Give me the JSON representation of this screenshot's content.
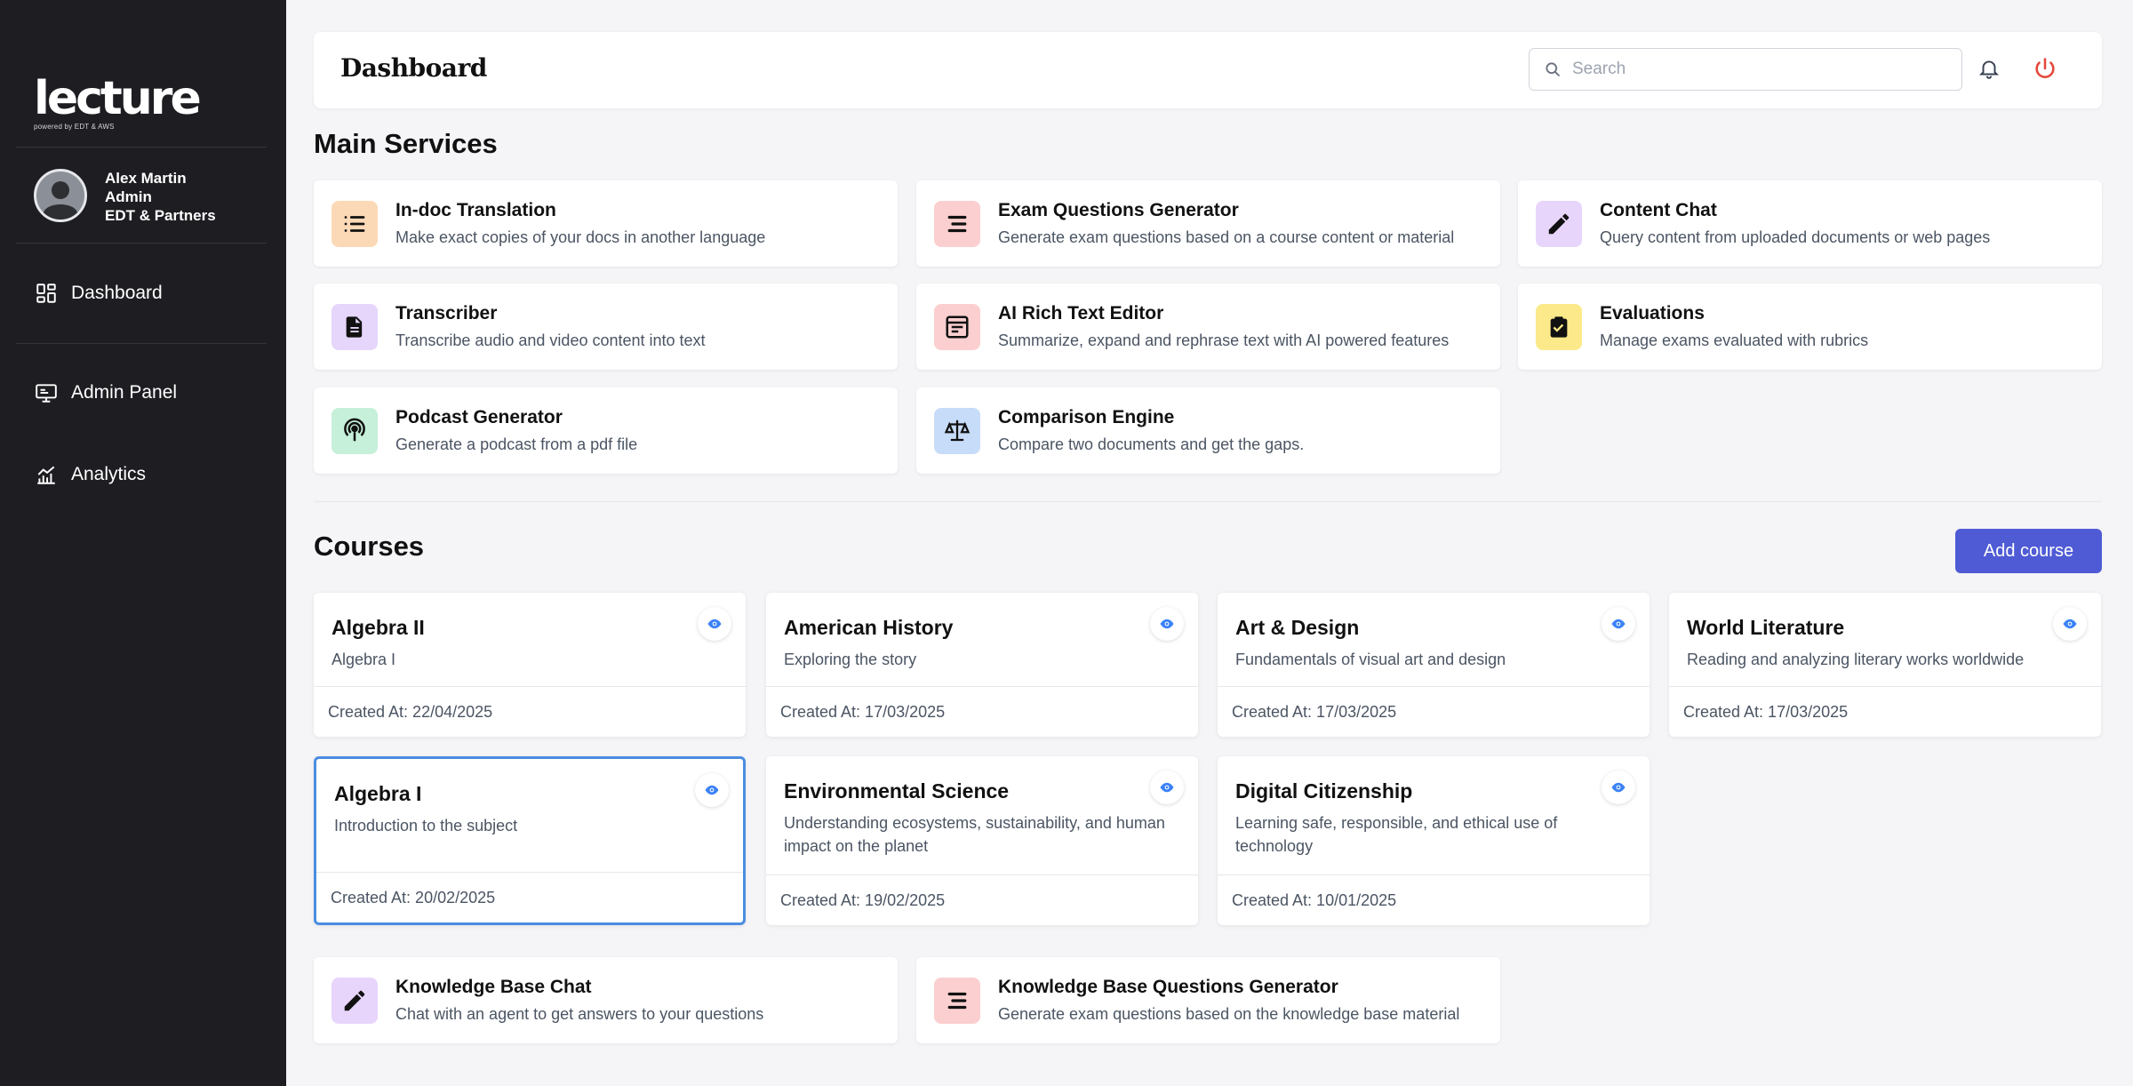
{
  "sidebar": {
    "logo_text": "lecture",
    "logo_sub": "powered by EDT & AWS",
    "user": {
      "name": "Alex Martin",
      "role": "Admin",
      "org": "EDT & Partners"
    },
    "nav": [
      {
        "label": "Dashboard",
        "icon": "dashboard-icon"
      },
      {
        "label": "Admin Panel",
        "icon": "admin-panel-icon"
      },
      {
        "label": "Analytics",
        "icon": "analytics-icon"
      }
    ]
  },
  "header": {
    "title": "Dashboard",
    "search_placeholder": "Search",
    "bell_icon": "bell-icon",
    "power_icon": "power-icon",
    "power_color": "#e5483b"
  },
  "main_services": {
    "title": "Main Services",
    "items": [
      {
        "title": "In-doc Translation",
        "desc": "Make exact copies of your docs in another language",
        "icon": "list-icon",
        "bg": "#fcd9b6"
      },
      {
        "title": "Exam Questions Generator",
        "desc": "Generate exam questions based on a course content or material",
        "icon": "lines-icon",
        "bg": "#fbcfcf"
      },
      {
        "title": "Content Chat",
        "desc": "Query content from uploaded documents or web pages",
        "icon": "pencil-icon",
        "bg": "#e8d5fb"
      },
      {
        "title": "Transcriber",
        "desc": "Transcribe audio and video content into text",
        "icon": "document-icon",
        "bg": "#e6d6fb"
      },
      {
        "title": "AI Rich Text Editor",
        "desc": "Summarize, expand and rephrase text with AI powered features",
        "icon": "text-editor-icon",
        "bg": "#fbcfcf"
      },
      {
        "title": "Evaluations",
        "desc": "Manage exams evaluated with rubrics",
        "icon": "clipboard-check-icon",
        "bg": "#fbe98a"
      },
      {
        "title": "Podcast Generator",
        "desc": "Generate a podcast from a pdf file",
        "icon": "podcast-icon",
        "bg": "#c6f0d9"
      },
      {
        "title": "Comparison Engine",
        "desc": "Compare two documents and get the gaps.",
        "icon": "scale-icon",
        "bg": "#c7dcf8"
      }
    ]
  },
  "courses": {
    "title": "Courses",
    "add_label": "Add course",
    "add_color": "#4f5bd5",
    "items": [
      {
        "title": "Algebra II",
        "desc": "Algebra I",
        "date": "Created At: 22/04/2025"
      },
      {
        "title": "American History",
        "desc": "Exploring the story",
        "date": "Created At: 17/03/2025"
      },
      {
        "title": "Art & Design",
        "desc": "Fundamentals of visual art and design",
        "date": "Created At: 17/03/2025"
      },
      {
        "title": "World Literature",
        "desc": "Reading and analyzing literary works worldwide",
        "date": "Created At: 17/03/2025"
      },
      {
        "title": "Algebra I",
        "desc": "Introduction to the subject",
        "date": "Created At: 20/02/2025",
        "selected": true
      },
      {
        "title": "Environmental Science",
        "desc": "Understanding ecosystems, sustainability, and human impact on the planet",
        "date": "Created At: 19/02/2025"
      },
      {
        "title": "Digital Citizenship",
        "desc": "Learning safe, responsible, and ethical use of technology",
        "date": "Created At: 10/01/2025"
      }
    ]
  },
  "knowledge": {
    "items": [
      {
        "title": "Knowledge Base Chat",
        "desc": "Chat with an agent to get answers to your questions",
        "icon": "pencil-icon",
        "bg": "#e8d5fb"
      },
      {
        "title": "Knowledge Base Questions Generator",
        "desc": "Generate exam questions based on the knowledge base material",
        "icon": "lines-icon",
        "bg": "#fbcfcf"
      }
    ]
  }
}
